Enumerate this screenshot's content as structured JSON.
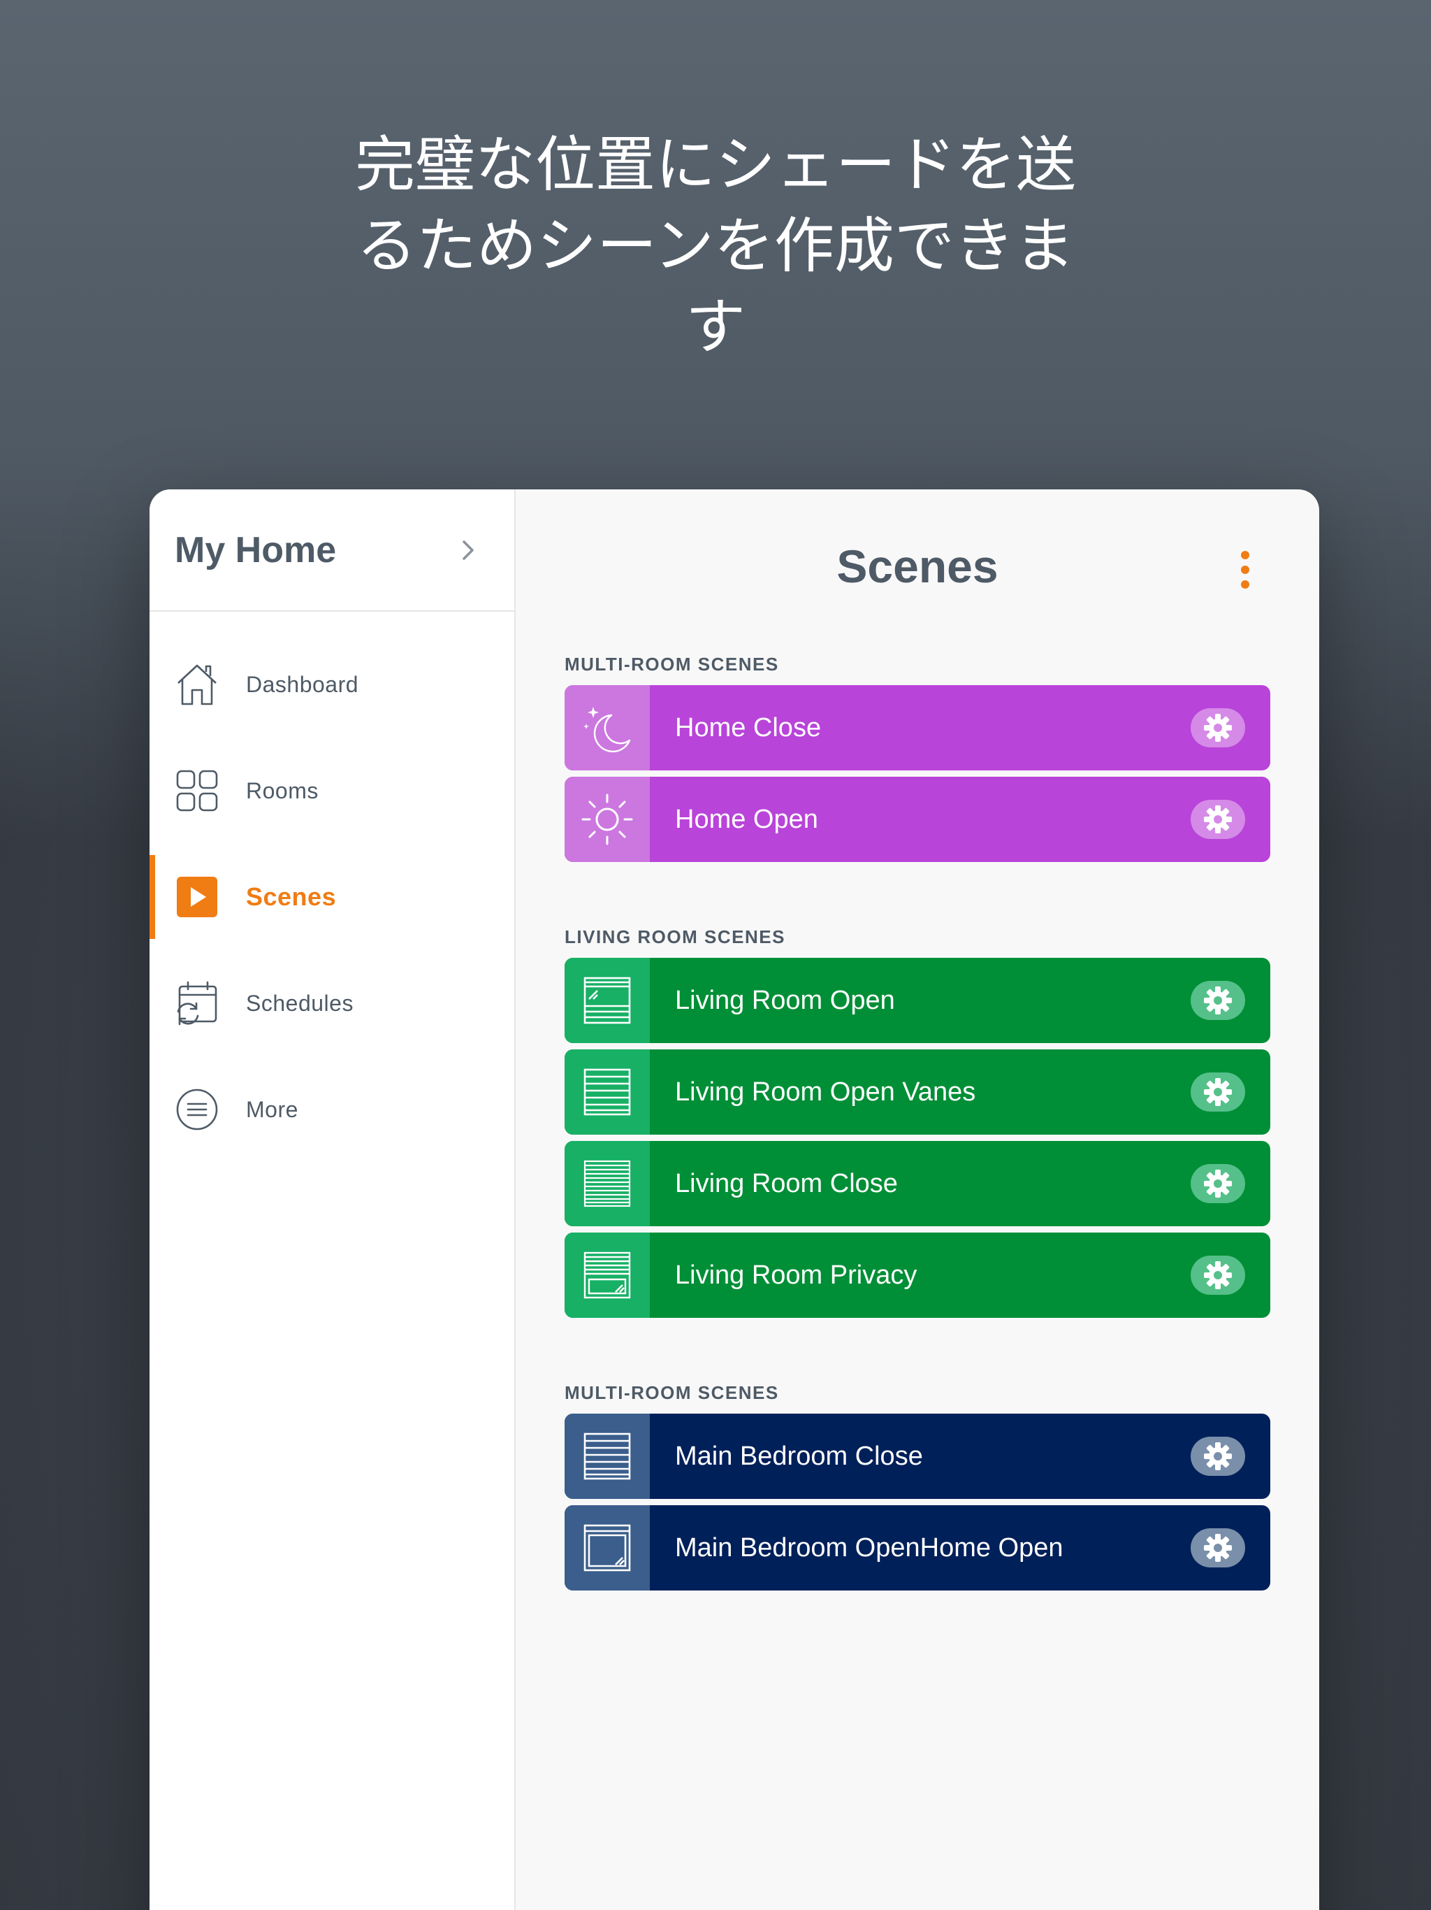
{
  "headline": {
    "line1": "完璧な位置にシェードを送",
    "line2": "るためシーンを作成できま",
    "line3": "す"
  },
  "sidebar": {
    "home_title": "My Home",
    "items": [
      {
        "label": "Dashboard",
        "icon": "house-icon"
      },
      {
        "label": "Rooms",
        "icon": "grid-icon"
      },
      {
        "label": "Scenes",
        "icon": "play-icon",
        "active": true
      },
      {
        "label": "Schedules",
        "icon": "calendar-sync-icon"
      },
      {
        "label": "More",
        "icon": "menu-circle-icon"
      }
    ]
  },
  "main": {
    "title": "Scenes",
    "sections": [
      {
        "title": "MULTI-ROOM SCENES",
        "color": "#b944d9",
        "scenes": [
          {
            "label": "Home Close",
            "icon": "moon-stars-icon"
          },
          {
            "label": "Home Open",
            "icon": "sun-icon"
          }
        ]
      },
      {
        "title": "LIVING ROOM SCENES",
        "color": "#008f36",
        "scenes": [
          {
            "label": "Living Room Open",
            "icon": "shade-open-icon"
          },
          {
            "label": "Living Room Open Vanes",
            "icon": "shade-vanes-icon"
          },
          {
            "label": "Living Room Close",
            "icon": "shade-closed-icon"
          },
          {
            "label": "Living Room Privacy",
            "icon": "shade-privacy-icon"
          }
        ]
      },
      {
        "title": "MULTI-ROOM SCENES",
        "color": "#002059",
        "scenes": [
          {
            "label": "Main Bedroom Close",
            "icon": "shade-vanes-icon"
          },
          {
            "label": "Main Bedroom OpenHome Open",
            "icon": "shade-window-icon"
          }
        ]
      }
    ]
  },
  "colors": {
    "accent": "#f07c14",
    "text": "#4e5a66"
  }
}
